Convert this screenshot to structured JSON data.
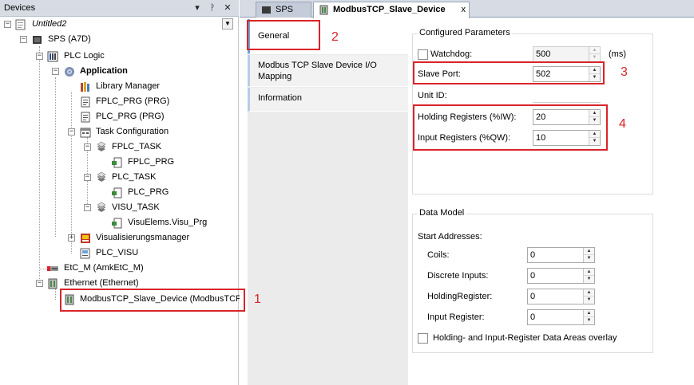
{
  "devices_panel": {
    "title": "Devices",
    "header_buttons": [
      "▾",
      "ᚹ",
      "✕"
    ],
    "tree": [
      {
        "label": "Untitled2",
        "italic": true
      },
      {
        "label": "SPS (A7D)"
      },
      {
        "label": "PLC Logic"
      },
      {
        "label": "Application",
        "bold": true
      },
      {
        "label": "Library Manager"
      },
      {
        "label": "FPLC_PRG (PRG)"
      },
      {
        "label": "PLC_PRG (PRG)"
      },
      {
        "label": "Task Configuration"
      },
      {
        "label": "FPLC_TASK"
      },
      {
        "label": "FPLC_PRG"
      },
      {
        "label": "PLC_TASK"
      },
      {
        "label": "PLC_PRG"
      },
      {
        "label": "VISU_TASK"
      },
      {
        "label": "VisuElems.Visu_Prg"
      },
      {
        "label": "Visualisierungsmanager"
      },
      {
        "label": "PLC_VISU"
      },
      {
        "label": "EtC_M (AmkEtC_M)"
      },
      {
        "label": "Ethernet (Ethernet)"
      },
      {
        "label": "ModbusTCP_Slave_Device (ModbusTCP S"
      }
    ]
  },
  "editor": {
    "tabs": [
      {
        "label": "SPS"
      },
      {
        "label": "ModbusTCP_Slave_Device",
        "active": true
      }
    ],
    "tab_close": "x",
    "side_tabs": [
      {
        "label": "General",
        "active": true
      },
      {
        "label": "Modbus TCP Slave Device I/O Mapping"
      },
      {
        "label": "Information"
      }
    ],
    "configured": {
      "title": "Configured Parameters",
      "watchdog_label": "Watchdog:",
      "watchdog_value": "500",
      "watchdog_unit": "(ms)",
      "slave_port_label": "Slave Port:",
      "slave_port_value": "502",
      "unit_id_label": "Unit ID:",
      "holding_label": "Holding Registers (%IW):",
      "holding_value": "20",
      "input_label": "Input Registers (%QW):",
      "input_value": "10"
    },
    "data_model": {
      "title": "Data Model",
      "start_addresses_label": "Start Addresses:",
      "coils_label": "Coils:",
      "coils_value": "0",
      "discrete_label": "Discrete Inputs:",
      "discrete_value": "0",
      "holding_register_label": "HoldingRegister:",
      "holding_register_value": "0",
      "input_register_label": "Input Register:",
      "input_register_value": "0",
      "overlay_label": "Holding- and Input-Register Data Areas overlay"
    }
  },
  "annotations": [
    "1",
    "2",
    "3",
    "4"
  ],
  "colors": {
    "annotation_red": "#d9252a",
    "header_bg": "#d6dbe4",
    "side_tab_accent": "#6fa3d8"
  }
}
